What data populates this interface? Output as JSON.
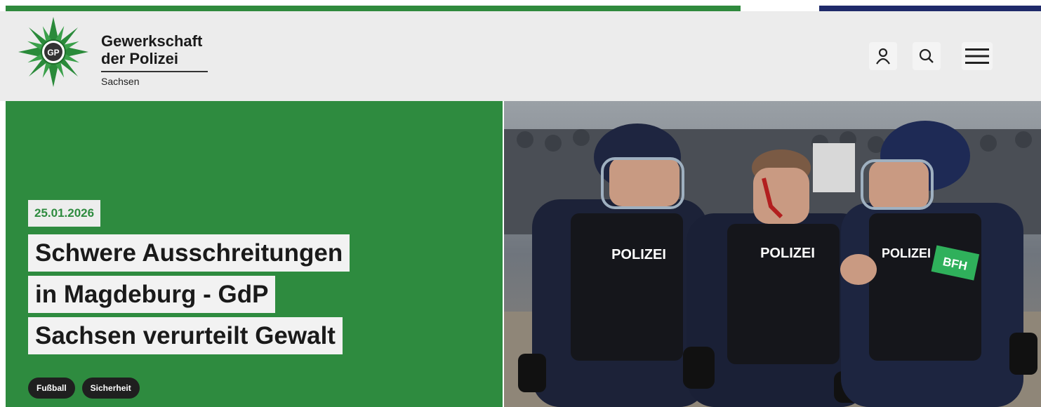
{
  "brand": {
    "line1": "Gewerkschaft",
    "line2": "der Polizei",
    "region": "Sachsen"
  },
  "header_icons": [
    "user-icon",
    "search-icon",
    "hamburger-menu-icon"
  ],
  "article": {
    "date": "25.01.2026",
    "headline_lines": [
      "Schwere Ausschreitungen",
      "in Magdeburg - GdP",
      "Sachsen verurteilt Gewalt"
    ],
    "tags": [
      "Fußball",
      "Sicherheit"
    ]
  },
  "photo": {
    "vest_labels": [
      "POLIZEI",
      "POLIZEI",
      "POLIZEI"
    ],
    "armband": "BFH"
  },
  "colors": {
    "brand_green": "#2e8b3f",
    "top_blue": "#1f2a6a",
    "header_bg": "#ececec"
  }
}
